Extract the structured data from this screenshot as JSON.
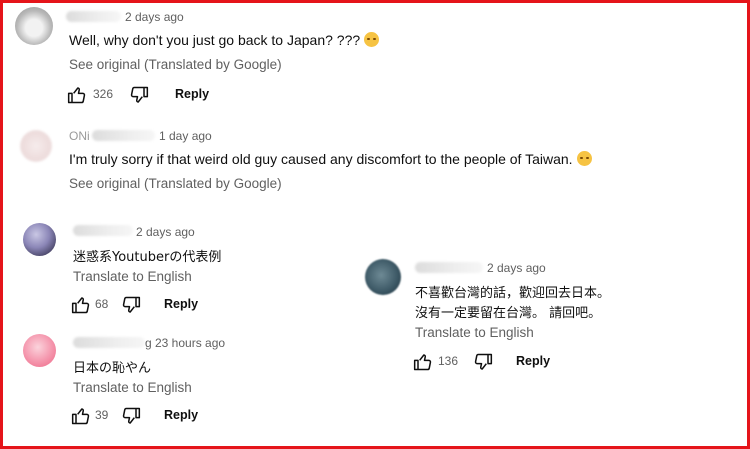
{
  "comments": [
    {
      "time": "2 days ago",
      "text": "Well, why don't you just go back to Japan? ???",
      "translate": "See original (Translated by Google)",
      "likes": "326",
      "reply": "Reply",
      "emoji": "relieved-face"
    },
    {
      "name_prefix": "ONi",
      "time": "1 day ago",
      "text": "I'm truly sorry if that weird old guy caused any discomfort to the people of Taiwan.",
      "translate": "See original (Translated by Google)",
      "emoji": "pensive-face"
    },
    {
      "time": "2 days ago",
      "text": "迷惑系Youtuberの代表例",
      "translate": "Translate to English",
      "likes": "68",
      "reply": "Reply"
    },
    {
      "name_suffix": "g",
      "time": "23 hours ago",
      "text": "日本の恥やん",
      "translate": "Translate to English",
      "likes": "39",
      "reply": "Reply"
    },
    {
      "time": "2 days ago",
      "text_line1": "不喜歡台灣的話，歡迎回去日本。",
      "text_line2": "沒有一定要留在台灣。 請回吧。",
      "translate": "Translate to English",
      "likes": "136",
      "reply": "Reply"
    }
  ],
  "colors": {
    "frame": "#e5141a",
    "text": "#0f0f0f",
    "muted": "#606060"
  }
}
